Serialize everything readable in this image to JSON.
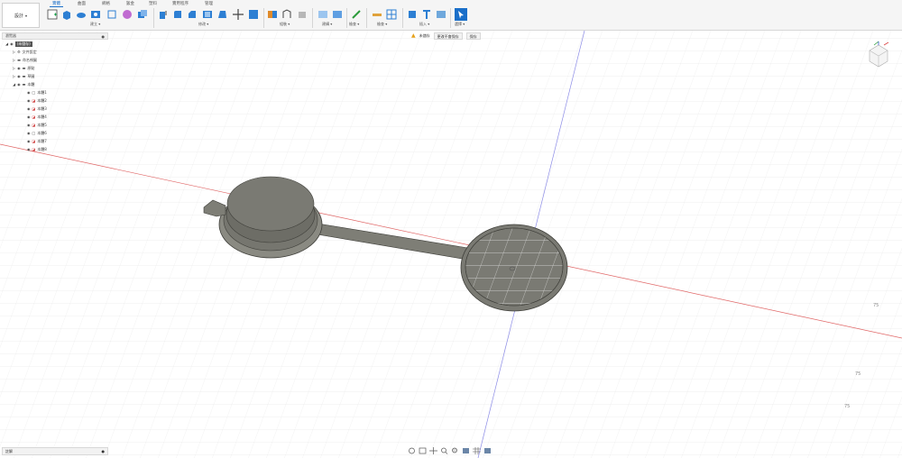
{
  "workspace": {
    "label": "設計"
  },
  "tabs": [
    {
      "label": "實體",
      "active": true
    },
    {
      "label": "曲面",
      "active": false
    },
    {
      "label": "網格",
      "active": false
    },
    {
      "label": "鈑金",
      "active": false
    },
    {
      "label": "塑料",
      "active": false
    },
    {
      "label": "實用程序",
      "active": false
    },
    {
      "label": "管理",
      "active": false
    }
  ],
  "toolbar_groups": {
    "create": "建立 ▾",
    "modify": "修改 ▾",
    "assemble": "組裝 ▾",
    "construct": "建構 ▾",
    "inspect": "檢查 ▾",
    "insert": "插入 ▾",
    "select": "選擇 ▾"
  },
  "browser": {
    "header": "瀏覽器",
    "root": "(未儲存)",
    "items": [
      "文件設定",
      "命名視圖",
      "原點",
      "草圖",
      "本體"
    ],
    "bodies": [
      "本體1",
      "本體2",
      "本體3",
      "本體4",
      "本體5",
      "本體6",
      "本體7",
      "本體8"
    ]
  },
  "notification": {
    "warning": "未儲存",
    "message": "更改不會保存",
    "save": "保存"
  },
  "comments": {
    "label": "註解"
  },
  "axis_labels": [
    "75",
    "75",
    "75"
  ],
  "colors": {
    "accent": "#1a6fc9",
    "x_axis": "#e06666",
    "y_axis": "#7f7fe0",
    "model": "#7e7e76"
  }
}
